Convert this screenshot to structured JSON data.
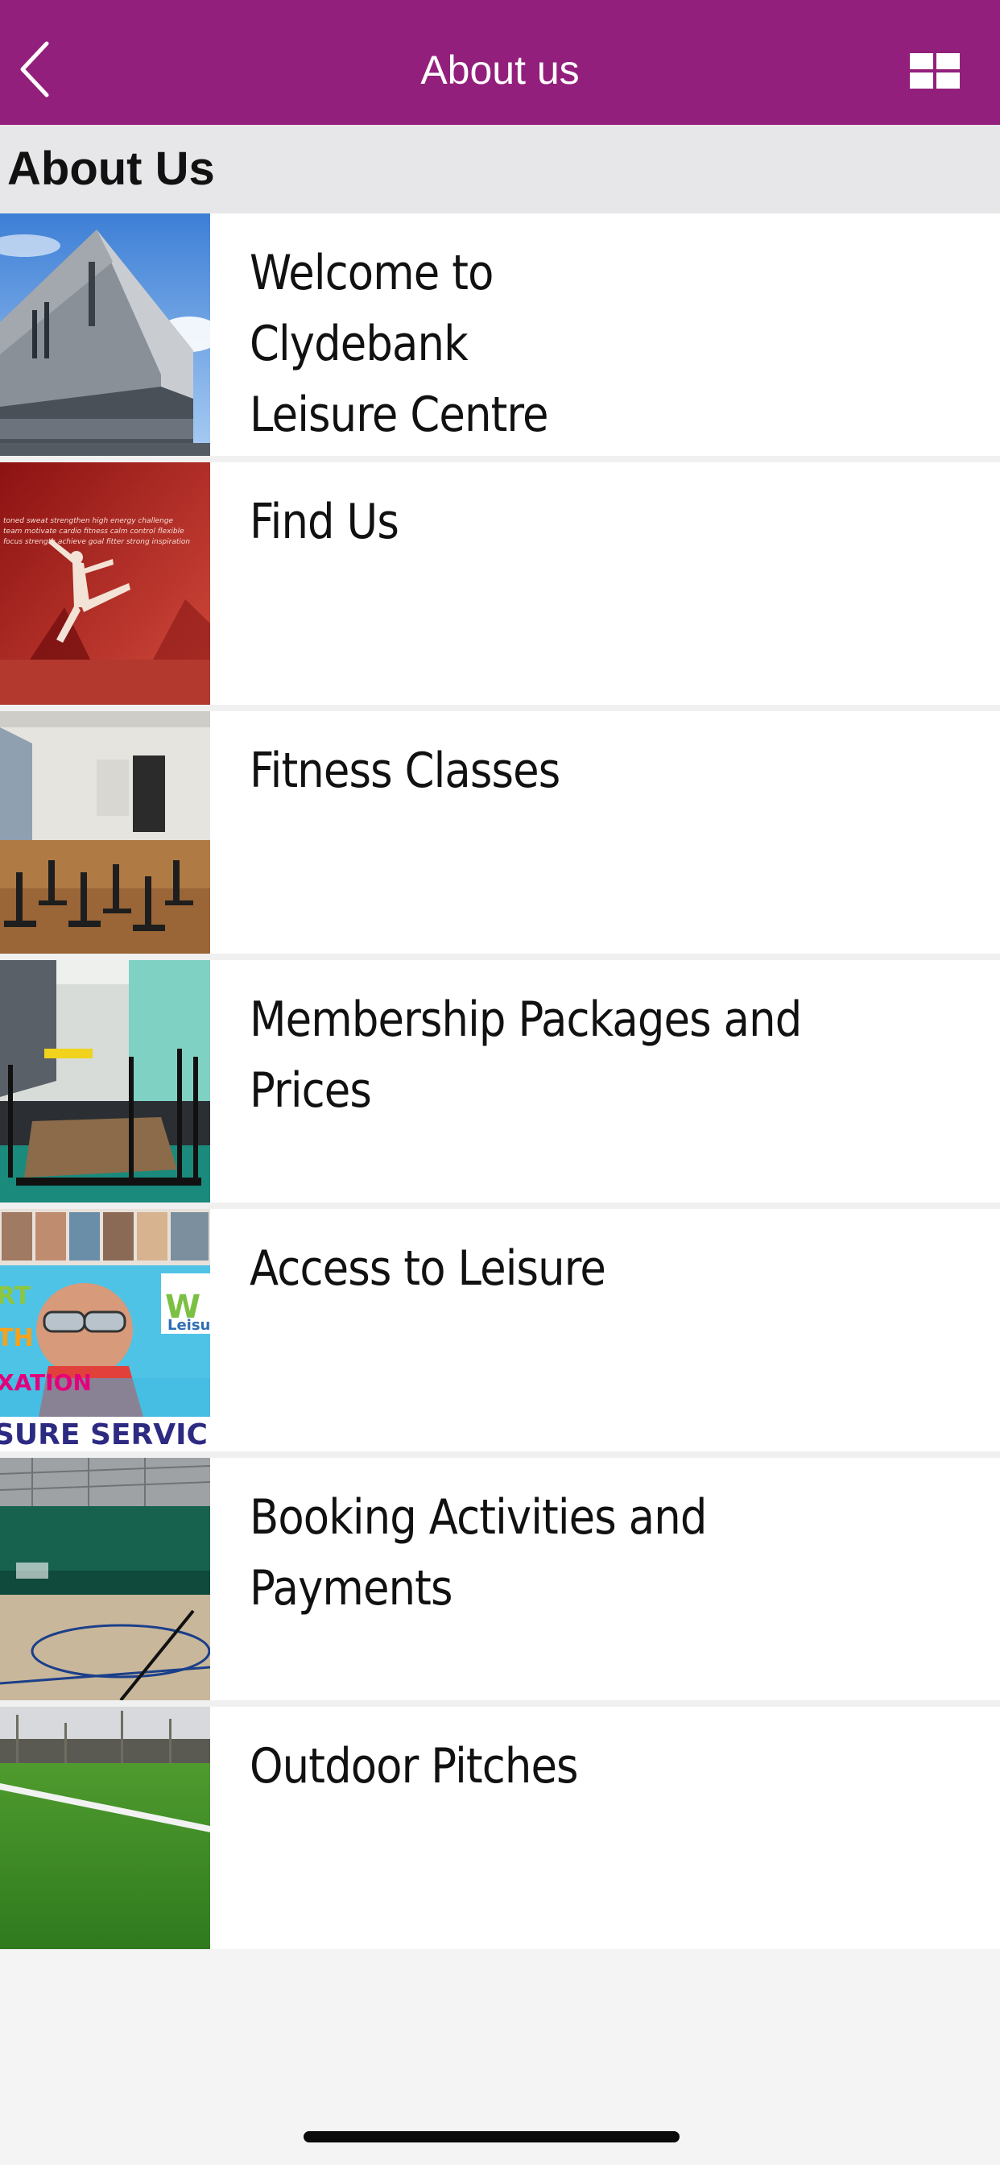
{
  "navbar": {
    "title": "About us",
    "back_icon": "chevron-left-icon",
    "menu_icon": "grid-icon",
    "background": "#931f7c"
  },
  "section": {
    "title": "About Us"
  },
  "items": [
    {
      "label": "Welcome to Clydebank\nLeisure Centre",
      "image": "building-exterior-photo"
    },
    {
      "label": "Find Us",
      "image": "dancer-red-wall-photo"
    },
    {
      "label": "Fitness Classes",
      "image": "spin-bikes-studio-photo"
    },
    {
      "label": "Membership Packages and Prices",
      "image": "gym-equipment-photo"
    },
    {
      "label": "Access to Leisure",
      "image": "leisure-services-poster"
    },
    {
      "label": "Booking Activities and Payments",
      "image": "sports-hall-photo"
    },
    {
      "label": "Outdoor Pitches",
      "image": "grass-pitch-photo"
    }
  ],
  "thumb_text": {
    "poster_lines": [
      "RT",
      "TH",
      "XATION",
      "SURE SERVICE"
    ],
    "poster_logo": "Leisu",
    "wall_words": "toned sweat strengthen high energy challenge team motivate cardio fitness calm control flexible focus strength achieve goal fitter strong inspiration"
  }
}
